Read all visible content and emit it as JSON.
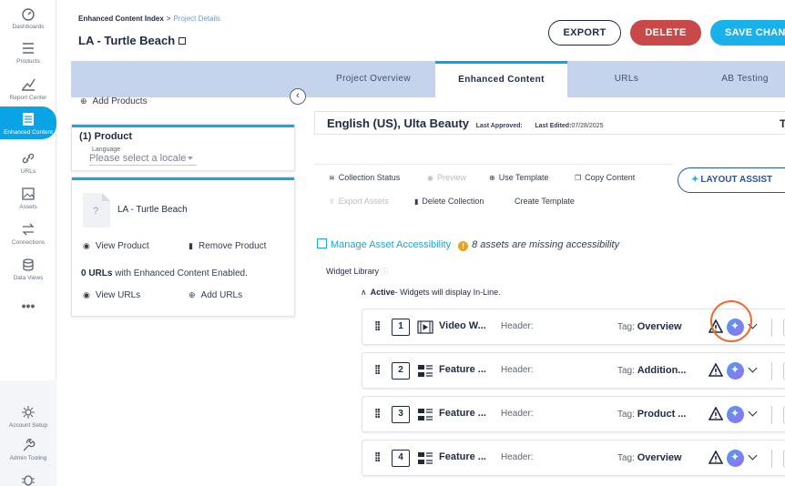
{
  "nav": {
    "items": [
      {
        "label": "Dashboards",
        "icon": "dashboard-icon"
      },
      {
        "label": "Products",
        "icon": "products-icon"
      },
      {
        "label": "Report Center",
        "icon": "report-icon"
      },
      {
        "label": "Enhanced Content",
        "icon": "enhanced-content-icon"
      },
      {
        "label": "URLs",
        "icon": "link-icon"
      },
      {
        "label": "Assets",
        "icon": "image-icon"
      },
      {
        "label": "Connections",
        "icon": "connections-icon"
      },
      {
        "label": "Data Views",
        "icon": "database-icon"
      },
      {
        "label": "•••",
        "icon": "more-icon"
      }
    ],
    "bottom": [
      {
        "label": "Account Setup",
        "icon": "account-setup-icon"
      },
      {
        "label": "Admin Tooling",
        "icon": "wrench-icon"
      }
    ],
    "active_color": "#0aa3e6"
  },
  "header": {
    "crumb_parent": "Enhanced Content Index",
    "crumb_sep": ">",
    "crumb_current": "Project Details",
    "title": "LA - Turtle Beach",
    "export_label": "EXPORT",
    "delete_label": "DELETE",
    "save_label": "SAVE CHAN"
  },
  "tabs": [
    {
      "label": "Project Overview"
    },
    {
      "label": "Enhanced Content"
    },
    {
      "label": "URLs"
    },
    {
      "label": "AB Testing"
    }
  ],
  "left": {
    "add_products": "Add Products",
    "collapse_glyph": "‹",
    "product_header": "(1) Product",
    "language_label": "Language",
    "language_placeholder": "Please select a locale",
    "thumb_glyph": "?",
    "product_name": "LA - Turtle Beach",
    "view_product": "View Product",
    "remove_product": "Remove Product",
    "urls_count": "0 URLs",
    "urls_text": " with Enhanced Content Enabled.",
    "view_urls": "View URLs",
    "add_urls": "Add URLs"
  },
  "content": {
    "locale": "English (US), Ulta Beauty",
    "last_approved": "Last Approved:",
    "last_edited_label": "Last Edited:",
    "last_edited_value": "07/28/2025",
    "locale_right_char": "T",
    "tools": {
      "collection_status": "Collection Status",
      "preview": "Preview",
      "use_template": "Use Template",
      "copy_content": "Copy Content",
      "export_assets": "Export Assets",
      "delete_collection": "Delete Collection",
      "create_template": "Create Template"
    },
    "layout_assist": "LAYOUT ASSIST",
    "manage_accessibility": "Manage Asset Accessibility",
    "missing_msg": "8 assets are missing accessibility",
    "widget_library": "Widget Library",
    "active_label": "Active",
    "active_desc": "- Widgets will display In-Line.",
    "widgets": [
      {
        "num": "1",
        "name": "Video W...",
        "header": "Header:",
        "tag_label": "Tag: ",
        "tag": "Overview",
        "icon": "video-widget-icon"
      },
      {
        "num": "2",
        "name": "Feature ...",
        "header": "Header:",
        "tag_label": "Tag: ",
        "tag": "Addition...",
        "icon": "feature-widget-icon"
      },
      {
        "num": "3",
        "name": "Feature ...",
        "header": "Header:",
        "tag_label": "Tag: ",
        "tag": "Product ...",
        "icon": "feature-widget-icon"
      },
      {
        "num": "4",
        "name": "Feature ...",
        "header": "Header:",
        "tag_label": "Tag: ",
        "tag": "Overview",
        "icon": "feature-widget-icon"
      }
    ]
  },
  "colors": {
    "primary": "#0aa3e6",
    "delete": "#c94848",
    "save": "#18b1ea",
    "highlight": "#ec6a2a",
    "warning": "#f2a20c"
  }
}
